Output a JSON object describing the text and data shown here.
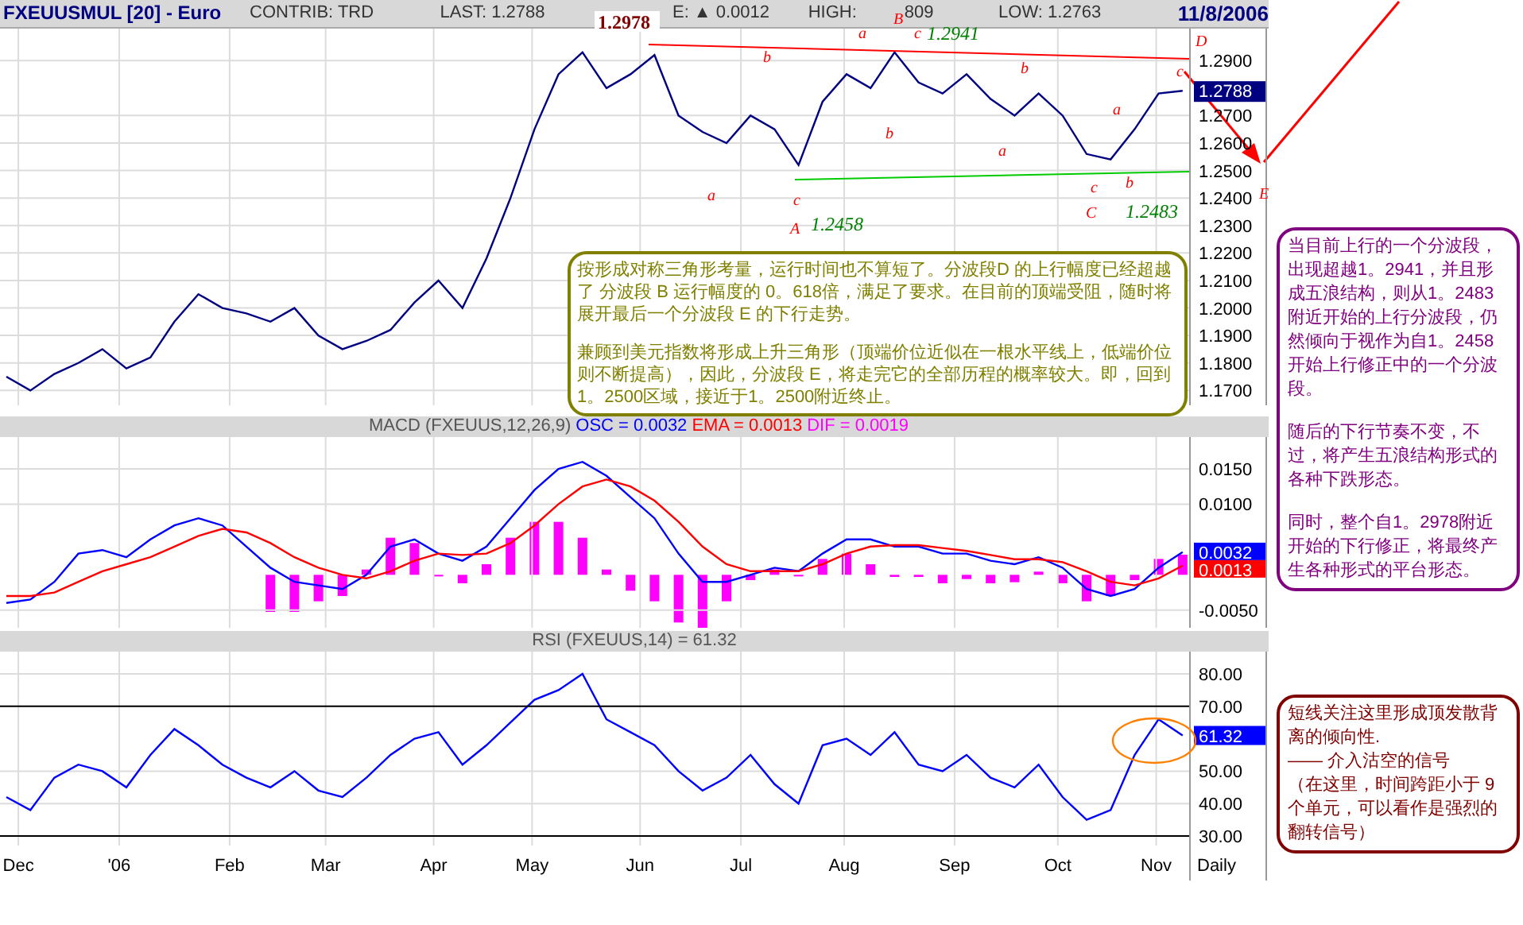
{
  "header": {
    "title": "FXEUUSMUL [20] - Euro",
    "contrib": "CONTRIB: TRD",
    "last": "LAST: 1.2788",
    "change": "E: ▲ 0.0012",
    "high_label": "HIGH:",
    "high_value": "809",
    "low": "LOW: 1.2763",
    "date": "11/8/2006"
  },
  "price_chart": {
    "chart_data": {
      "type": "line",
      "grid": true,
      "ylim": [
        1.1646,
        1.3016
      ],
      "yticks": [
        {
          "value": 1.29,
          "label": "1.2900"
        },
        {
          "value": 1.27,
          "label": "1.2700"
        },
        {
          "value": 1.26,
          "label": "1.2600"
        },
        {
          "value": 1.25,
          "label": "1.2500"
        },
        {
          "value": 1.24,
          "label": "1.2400"
        },
        {
          "value": 1.23,
          "label": "1.2300"
        },
        {
          "value": 1.22,
          "label": "1.2200"
        },
        {
          "value": 1.21,
          "label": "1.2100"
        },
        {
          "value": 1.2,
          "label": "1.2000"
        },
        {
          "value": 1.19,
          "label": "1.1900"
        },
        {
          "value": 1.18,
          "label": "1.1800"
        },
        {
          "value": 1.17,
          "label": "1.1700"
        }
      ],
      "series": [
        {
          "color": "#000080",
          "values": [
            1.175,
            1.17,
            1.176,
            1.18,
            1.185,
            1.178,
            1.182,
            1.195,
            1.205,
            1.2,
            1.198,
            1.195,
            1.2,
            1.19,
            1.185,
            1.188,
            1.192,
            1.202,
            1.21,
            1.2,
            1.218,
            1.24,
            1.265,
            1.285,
            1.293,
            1.28,
            1.285,
            1.292,
            1.27,
            1.264,
            1.26,
            1.27,
            1.265,
            1.252,
            1.275,
            1.285,
            1.28,
            1.293,
            1.282,
            1.278,
            1.285,
            1.276,
            1.27,
            1.278,
            1.27,
            1.256,
            1.254,
            1.265,
            1.278,
            1.279
          ]
        }
      ]
    },
    "labels": [
      {
        "text": "1.2978",
        "kind": "high"
      },
      {
        "text": "a",
        "kind": "wave"
      },
      {
        "text": "B",
        "kind": "wave"
      },
      {
        "text": "c",
        "kind": "wave"
      },
      {
        "text": "1.2941",
        "kind": "level"
      },
      {
        "text": "b",
        "kind": "wave"
      },
      {
        "text": "b",
        "kind": "wave"
      },
      {
        "text": "D",
        "kind": "wave"
      },
      {
        "text": "c",
        "kind": "wave"
      },
      {
        "text": "a",
        "kind": "wave"
      },
      {
        "text": "b",
        "kind": "wave"
      },
      {
        "text": "a",
        "kind": "wave"
      },
      {
        "text": "a",
        "kind": "wave"
      },
      {
        "text": "c",
        "kind": "wave"
      },
      {
        "text": "A",
        "kind": "wave"
      },
      {
        "text": "1.2458",
        "kind": "level"
      },
      {
        "text": "c",
        "kind": "wave"
      },
      {
        "text": "b",
        "kind": "wave"
      },
      {
        "text": "C",
        "kind": "wave"
      },
      {
        "text": "1.2483",
        "kind": "level"
      },
      {
        "text": "E",
        "kind": "wave"
      }
    ],
    "last_value": "1.2788",
    "note": {
      "paragraphs": [
        "按形成对称三角形考量，运行时间也不算短了。分波段D 的上行幅度已经超越了 分波段 B 运行幅度的 0。618倍，满足了要求。在目前的顶端受阻，随时将展开最后一个分波段 E 的下行走势。",
        "兼顾到美元指数将形成上升三角形（顶端价位近似在一根水平线上，低端价位则不断提高），因此，分波段 E，将走完它的全部历程的概率较大。即，回到1。2500区域，接近于1。2500附近终止。"
      ]
    }
  },
  "macd_chart": {
    "title": "MACD (FXEUUS,12,26,9)",
    "readouts": [
      {
        "text": "OSC = 0.0032",
        "color": "#0000ff"
      },
      {
        "text": "EMA = 0.0013",
        "color": "#ff0000"
      },
      {
        "text": "DIF = 0.0019",
        "color": "#ff00ff"
      }
    ],
    "chart_data": {
      "type": "line",
      "grid": true,
      "ylim": [
        -0.0075,
        0.0195
      ],
      "yticks": [
        {
          "value": 0.015,
          "label": "0.0150"
        },
        {
          "value": 0.01,
          "label": "0.0100"
        },
        {
          "value": -0.005,
          "label": "-0.0050"
        }
      ],
      "series": [
        {
          "color": "#0000ff",
          "values": [
            -0.004,
            -0.0035,
            -0.001,
            0.003,
            0.0035,
            0.0025,
            0.005,
            0.007,
            0.008,
            0.007,
            0.004,
            0.001,
            -0.001,
            -0.0015,
            -0.002,
            0,
            0.004,
            0.005,
            0.003,
            0.002,
            0.004,
            0.008,
            0.012,
            0.015,
            0.016,
            0.014,
            0.011,
            0.008,
            0.003,
            -0.001,
            -0.001,
            0,
            0.001,
            0.0005,
            0.003,
            0.005,
            0.005,
            0.004,
            0.004,
            0.003,
            0.003,
            0.002,
            0.0015,
            0.0025,
            0.001,
            -0.002,
            -0.003,
            -0.002,
            0.001,
            0.0032
          ]
        },
        {
          "color": "#ff0000",
          "values": [
            -0.003,
            -0.003,
            -0.0025,
            -0.001,
            0.0005,
            0.0015,
            0.0025,
            0.004,
            0.0055,
            0.0065,
            0.006,
            0.0045,
            0.0025,
            0.001,
            0,
            -0.0005,
            0.0005,
            0.002,
            0.003,
            0.0028,
            0.003,
            0.0045,
            0.007,
            0.01,
            0.0125,
            0.0135,
            0.0125,
            0.0105,
            0.0075,
            0.004,
            0.0015,
            0.0005,
            0.0005,
            0.0005,
            0.0015,
            0.003,
            0.004,
            0.0042,
            0.0042,
            0.0038,
            0.0034,
            0.0028,
            0.0022,
            0.0022,
            0.0018,
            0.0005,
            -0.001,
            -0.0015,
            -0.0005,
            0.0013
          ]
        }
      ]
    },
    "last_values": [
      {
        "text": "0.0032",
        "color": "#0000ff"
      },
      {
        "text": "0.0013",
        "color": "#ff0000"
      }
    ]
  },
  "rsi_chart": {
    "title": "RSI (FXEUUS,14) = 61.32",
    "chart_data": {
      "type": "line",
      "grid": true,
      "ylim": [
        27.06,
        86.86
      ],
      "yticks": [
        {
          "value": 80,
          "label": "80.00"
        },
        {
          "value": 70,
          "label": "70.00"
        },
        {
          "value": 50,
          "label": "50.00"
        },
        {
          "value": 40,
          "label": "40.00"
        },
        {
          "value": 30,
          "label": "30.00"
        }
      ],
      "series": [
        {
          "color": "#0000ff",
          "values": [
            42,
            38,
            48,
            52,
            50,
            45,
            55,
            63,
            58,
            52,
            48,
            45,
            50,
            44,
            42,
            48,
            55,
            60,
            62,
            52,
            58,
            65,
            72,
            75,
            80,
            66,
            62,
            58,
            50,
            44,
            48,
            55,
            46,
            40,
            58,
            60,
            55,
            62,
            52,
            50,
            55,
            48,
            45,
            52,
            42,
            35,
            38,
            55,
            66,
            61
          ]
        }
      ]
    },
    "last_value": "61.32"
  },
  "x_axis": {
    "months": [
      "Dec",
      "'06",
      "Feb",
      "Mar",
      "Apr",
      "May",
      "Jun",
      "Jul",
      "Aug",
      "Sep",
      "Oct",
      "Nov"
    ],
    "periodicity": "Daily"
  },
  "notes": [
    {
      "color": "#800080",
      "paragraphs": [
        "当目前上行的一个分波段，出现超越1。2941，并且形成五浪结构，则从1。2483附近开始的上行分波段，仍然倾向于视作为自1。2458开始上行修正中的一个分波段。",
        "随后的下行节奏不变，不过，将产生五浪结构形式的各种下跌形态。",
        "同时，整个自1。2978附近开始的下行修正，将最终产生各种形式的平台形态。"
      ]
    },
    {
      "color": "#800000",
      "lines": [
        "短线关注这里形成顶发散背离的倾向性.",
        "—— 介入沽空的信号",
        "（在这里，时间跨距小于 9 个单元，可以看作是强烈的翻转信号）"
      ]
    }
  ]
}
